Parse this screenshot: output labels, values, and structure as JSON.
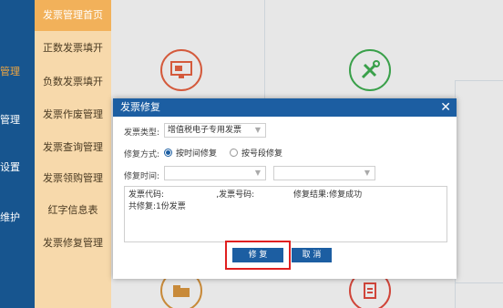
{
  "leftbar": {
    "items": [
      "管理",
      "管理",
      "设置",
      "维护"
    ]
  },
  "submenu": {
    "items": [
      "发票管理首页",
      "正数发票填开",
      "负数发票填开",
      "发票作废管理",
      "发票查询管理",
      "发票领购管理",
      "红字信息表",
      "发票修复管理"
    ]
  },
  "dialog": {
    "title": "发票修复",
    "close_label": "✕",
    "invoice_type_label": "发票类型:",
    "invoice_type_value": "增值税电子专用发票",
    "repair_mode_label": "修复方式:",
    "mode_time": "按时间修复",
    "mode_number": "按号段修复",
    "repair_time_label": "修复时间:",
    "result_line1": "发票代码:                    ,发票号码:               修复结果:修复成功",
    "result_line2": "共修复:1份发票",
    "repair_button": "修 复",
    "cancel_button": "取 消"
  },
  "colors": {
    "leftbar": "#17558f",
    "submenu": "#f7d9ab",
    "submenu_active": "#f2b15a",
    "dialog_header": "#1c5ea2",
    "highlight": "#e02020"
  },
  "icons": [
    "invoice-screen-icon",
    "tools-icon",
    "folder-icon",
    "document-icon"
  ]
}
